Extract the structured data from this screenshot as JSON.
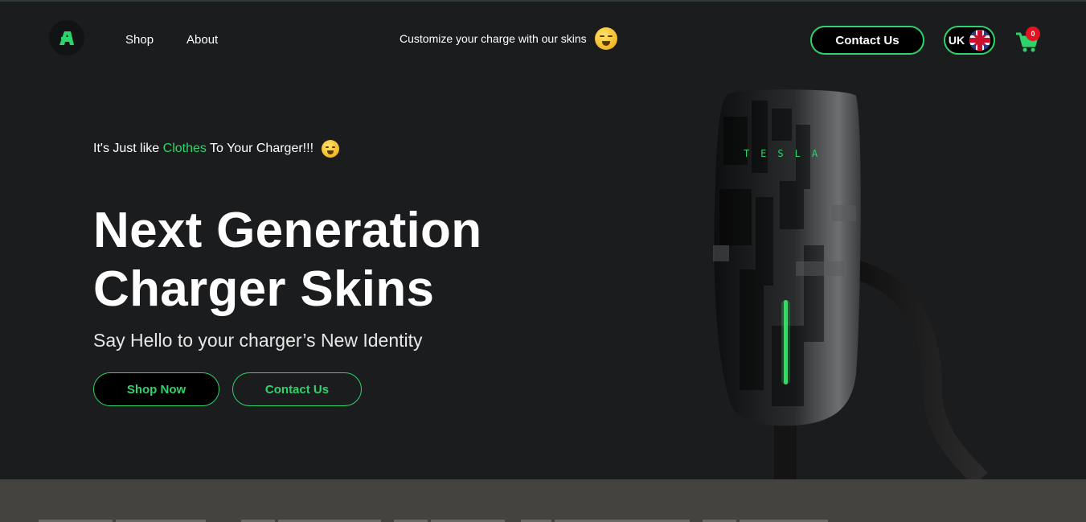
{
  "header": {
    "nav": [
      {
        "label": "Shop"
      },
      {
        "label": "About"
      }
    ],
    "promo_text": "Customize your charge with our skins",
    "contact_label": "Contact Us",
    "language_code": "UK",
    "cart_count": "0"
  },
  "hero": {
    "tagline_prefix": "It's Just like ",
    "tagline_highlight": "Clothes",
    "tagline_suffix": " To Your Charger!!!",
    "headline_line1": "Next Generation",
    "headline_line2": "Charger Skins",
    "subheading": "Say Hello to your charger’s New Identity",
    "shop_button": "Shop Now",
    "contact_button": "Contact Us",
    "charger_brand": "TESLA"
  },
  "icons": {
    "logo": "brand-logo-icon",
    "promo_emoji": "drooling-face-icon",
    "tagline_emoji": "drooling-face-icon",
    "flag": "uk-flag-icon",
    "cart": "shopping-cart-icon"
  },
  "colors": {
    "background": "#1b1c1e",
    "accent": "#2fd36b",
    "badge": "#e3141f",
    "bottom_band": "#45433f"
  }
}
